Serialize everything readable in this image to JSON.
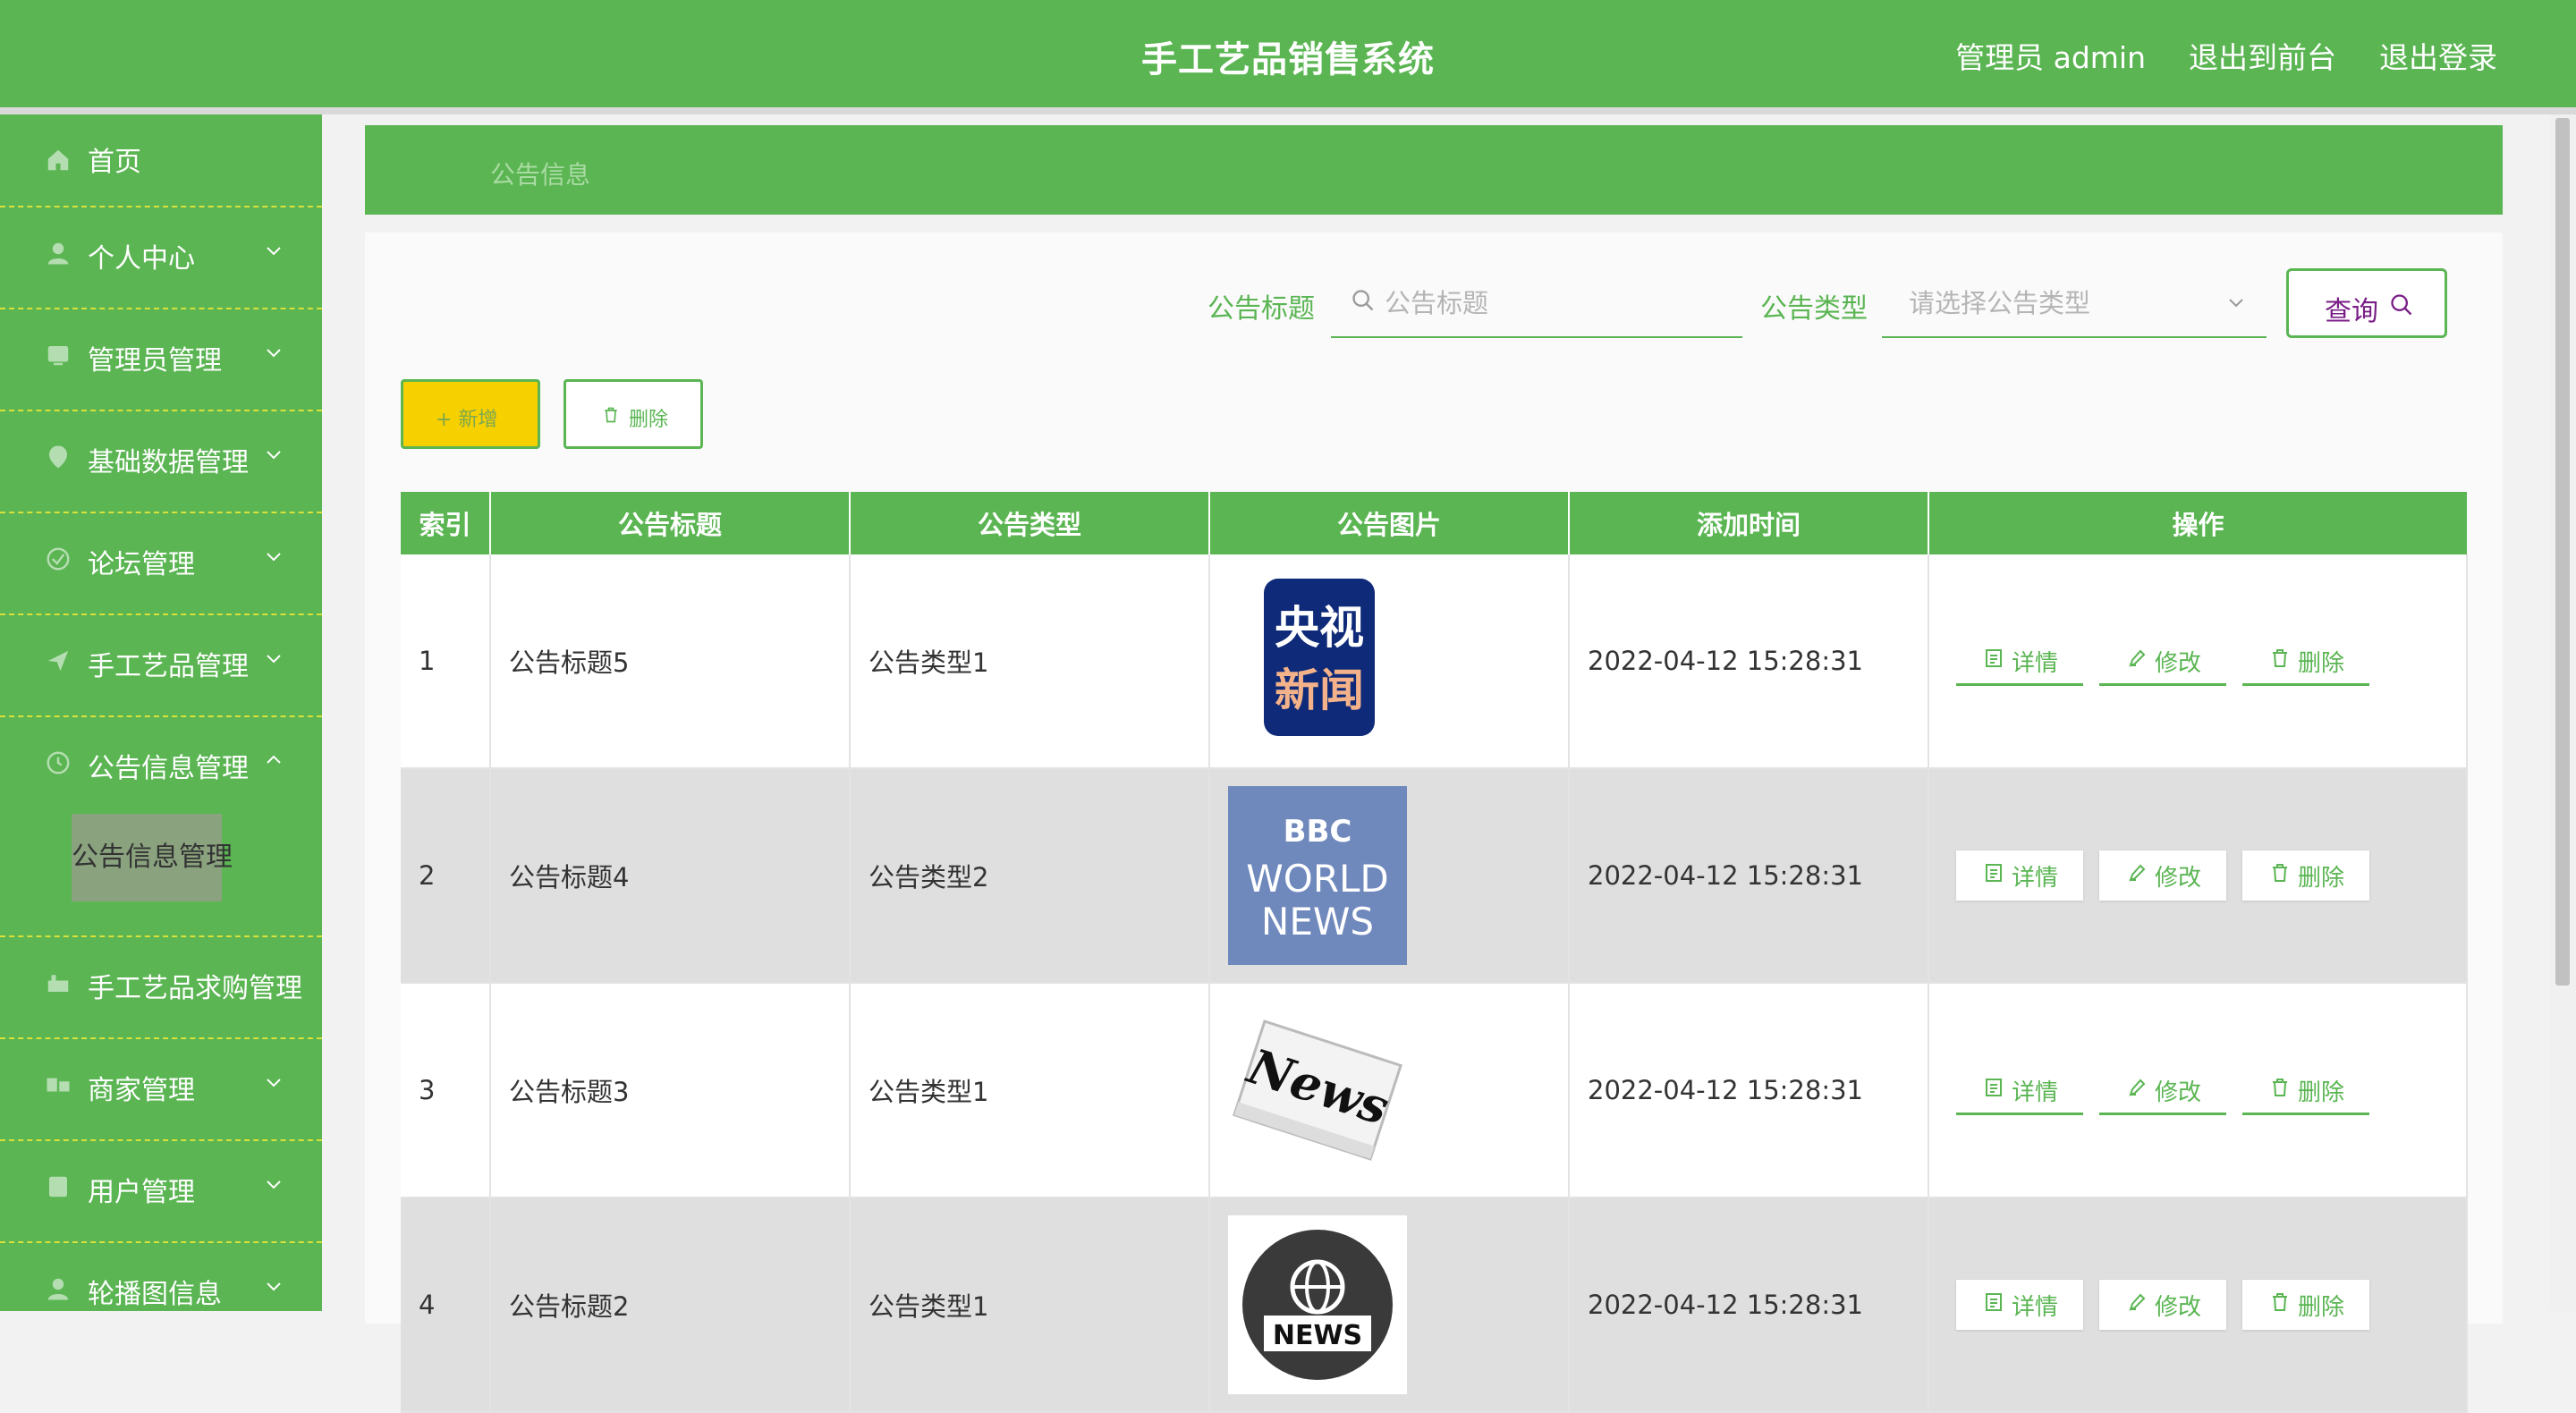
{
  "header": {
    "title": "手工艺品销售系统",
    "user_label": "管理员 admin",
    "to_front_label": "退出到前台",
    "logout_label": "退出登录"
  },
  "sidebar": {
    "items": [
      {
        "label": "首页",
        "icon": "home-icon"
      },
      {
        "label": "个人中心",
        "icon": "user-icon"
      },
      {
        "label": "管理员管理",
        "icon": "admin-icon"
      },
      {
        "label": "基础数据管理",
        "icon": "data-icon"
      },
      {
        "label": "论坛管理",
        "icon": "forum-icon"
      },
      {
        "label": "手工艺品管理",
        "icon": "craft-icon"
      },
      {
        "label": "公告信息管理",
        "icon": "notice-icon",
        "sub": "公告信息管理"
      },
      {
        "label": "手工艺品求购管理",
        "icon": "purchase-icon"
      },
      {
        "label": "商家管理",
        "icon": "merchant-icon"
      },
      {
        "label": "用户管理",
        "icon": "users-icon"
      },
      {
        "label": "轮播图信息",
        "icon": "carousel-icon"
      }
    ]
  },
  "breadcrumb": "公告信息",
  "search": {
    "title_label": "公告标题",
    "title_placeholder": "公告标题",
    "type_label": "公告类型",
    "type_placeholder": "请选择公告类型",
    "query_label": "查询"
  },
  "toolbar": {
    "add_label": "+ 新增",
    "delete_label": "删除"
  },
  "table": {
    "columns": [
      "索引",
      "公告标题",
      "公告类型",
      "公告图片",
      "添加时间",
      "操作"
    ],
    "rows": [
      {
        "index": "1",
        "title": "公告标题5",
        "type": "公告类型1",
        "image": "cctv-news-logo",
        "time": "2022-04-12 15:28:31"
      },
      {
        "index": "2",
        "title": "公告标题4",
        "type": "公告类型2",
        "image": "bbc-world-news-logo",
        "time": "2022-04-12 15:28:31"
      },
      {
        "index": "3",
        "title": "公告标题3",
        "type": "公告类型1",
        "image": "newspaper-news",
        "time": "2022-04-12 15:28:31"
      },
      {
        "index": "4",
        "title": "公告标题2",
        "type": "公告类型1",
        "image": "news-globe-icon",
        "time": "2022-04-12 15:28:31"
      }
    ],
    "ops": {
      "detail": "详情",
      "edit": "修改",
      "delete": "删除"
    }
  },
  "images": {
    "cctv_line1": "央视",
    "cctv_line2": "新闻",
    "bbc_brand": "BBC",
    "bbc_line1": "WORLD",
    "bbc_line2": "NEWS",
    "newspaper_word": "News",
    "globe_word": "NEWS"
  },
  "colors": {
    "primary": "#5ab552",
    "add_button": "#f7d000",
    "query_text": "#7a1e87",
    "dashed_separator": "#d9e13a"
  }
}
